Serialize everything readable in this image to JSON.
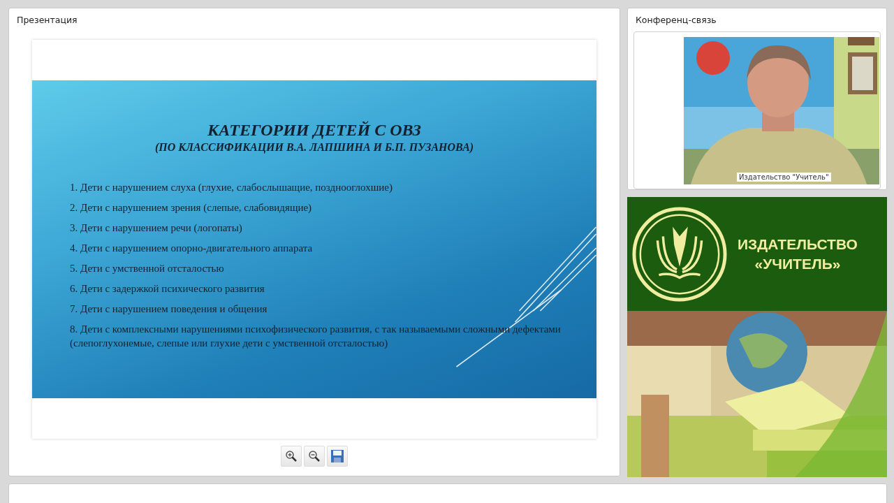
{
  "presentation": {
    "title": "Презентация",
    "slide": {
      "heading": "КАТЕГОРИИ ДЕТЕЙ С ОВЗ",
      "subheading": "(ПО КЛАССИФИКАЦИИ В.А. ЛАПШИНА И Б.П. ПУЗАНОВА)",
      "items": [
        "1. Дети с нарушением слуха (глухие, слабослышащие, позднооглохшие)",
        "2. Дети с нарушением зрения (слепые, слабовидящие)",
        "3. Дети с нарушением речи (логопаты)",
        "4. Дети с нарушением опорно-двигательного аппарата",
        "5. Дети с умственной отсталостью",
        "6. Дети с задержкой психического развития",
        "7. Дети с нарушением поведения и общения",
        "8. Дети с комплексными нарушениями психофизического развития, с так называемыми сложными дефектами (слепоглухонемые, слепые или глухие дети с умственной отсталостью)"
      ]
    },
    "toolbar": [
      {
        "kind": "zoom-in"
      },
      {
        "kind": "zoom-out"
      },
      {
        "kind": "save"
      }
    ]
  },
  "conference": {
    "title": "Конференц-связь",
    "video": {
      "kind": "picture",
      "caption": "Издательство \"Учитель\""
    }
  },
  "banner": {
    "line_1": "ИЗДАТЕЛЬСТВО",
    "line_2": "«УЧИТЕЛЬ»"
  }
}
